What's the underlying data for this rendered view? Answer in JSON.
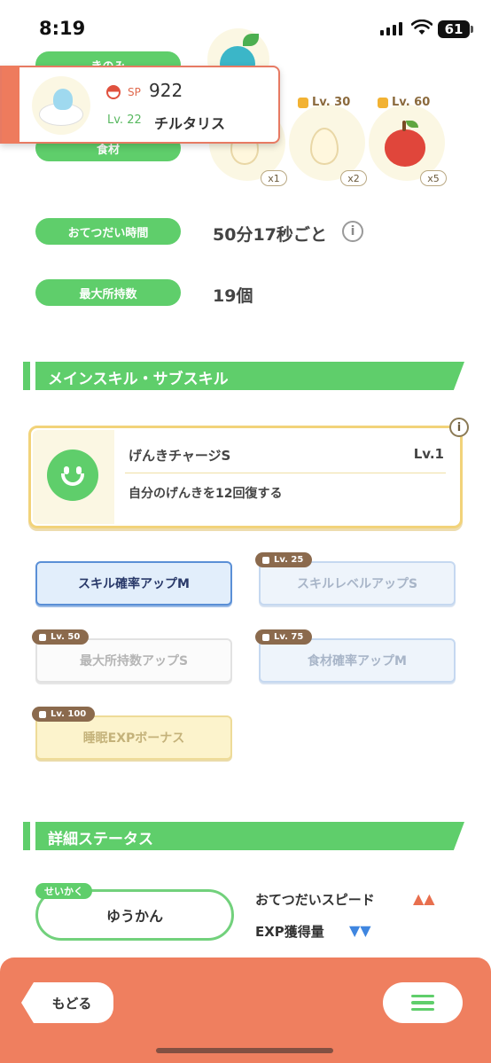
{
  "status_bar": {
    "time": "8:19",
    "battery": "61"
  },
  "top": {
    "berry_label": "きのみ",
    "ingredient_label": "食材",
    "ingredients": [
      {
        "icon": "egg-icon",
        "qty": "x1",
        "lock": ""
      },
      {
        "icon": "egg-icon",
        "qty": "x2",
        "lock": "Lv. 30"
      },
      {
        "icon": "apple-icon",
        "qty": "x5",
        "lock": "Lv. 60"
      }
    ],
    "help_time_label": "おてつだい時間",
    "help_time_value": "50分17秒ごと",
    "max_carry_label": "最大所持数",
    "max_carry_value": "19個"
  },
  "popup": {
    "sp_label": "SP",
    "sp_value": "922",
    "level": "Lv. 22",
    "name": "チルタリス"
  },
  "skills_section": {
    "title": "メインスキル・サブスキル",
    "main_skill": {
      "name": "げんきチャージS",
      "level": "Lv.1",
      "description": "自分のげんきを12回復する",
      "info": "i"
    },
    "sub_skills": [
      {
        "label": "スキル確率アップM",
        "lock": ""
      },
      {
        "label": "スキルレベルアップS",
        "lock": "Lv. 25"
      },
      {
        "label": "最大所持数アップS",
        "lock": "Lv. 50"
      },
      {
        "label": "食材確率アップM",
        "lock": "Lv. 75"
      },
      {
        "label": "睡眠EXPボーナス",
        "lock": "Lv. 100"
      }
    ]
  },
  "details_section": {
    "title": "詳細ステータス",
    "nature_tag": "せいかく",
    "nature_value": "ゆうかん",
    "stats": [
      {
        "label": "おてつだいスピード",
        "arrows": "▲▲",
        "color": "#e86f4e"
      },
      {
        "label": "EXP獲得量",
        "arrows": "▼▼",
        "color": "#3f86e0"
      }
    ]
  },
  "bottom_bar": {
    "back_label": "もどる"
  },
  "colors": {
    "accent_green": "#5fce6b",
    "bottom_bar": "#ef7f5f"
  }
}
